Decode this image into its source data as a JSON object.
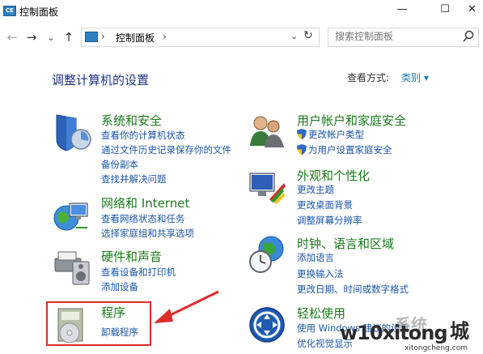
{
  "window": {
    "title": "控制面板",
    "minimize": "—",
    "maximize": "☐",
    "close": "✕"
  },
  "nav": {
    "back": "←",
    "forward": "→",
    "recent": "⌄",
    "up": "↑"
  },
  "address": {
    "path": "控制面板",
    "separator": "›",
    "dropdown": "⌄",
    "refresh": "↻"
  },
  "search": {
    "placeholder": "搜索控制面板"
  },
  "header": {
    "title": "调整计算机的设置",
    "view_by_label": "查看方式:",
    "view_by_value": "类别 ▾"
  },
  "categories": {
    "system": {
      "title": "系统和安全",
      "links": [
        "查看你的计算机状态",
        "通过文件历史记录保存你的文件",
        "备份副本",
        "查找并解决问题"
      ]
    },
    "network": {
      "title": "网络和 Internet",
      "links": [
        "查看网络状态和任务",
        "选择家庭组和共享选项"
      ]
    },
    "hardware": {
      "title": "硬件和声音",
      "links": [
        "查看设备和打印机",
        "添加设备"
      ]
    },
    "programs": {
      "title": "程序",
      "links": [
        "卸载程序"
      ]
    },
    "users": {
      "title": "用户帐户和家庭安全",
      "links": [
        "更改帐户类型",
        "为用户设置家庭安全"
      ]
    },
    "appearance": {
      "title": "外观和个性化",
      "links": [
        "更改主题",
        "更改桌面背景",
        "调整屏幕分辨率"
      ]
    },
    "clock": {
      "title": "时钟、语言和区域",
      "links": [
        "添加语言",
        "更换输入法",
        "更改日期、时间或数字格式"
      ]
    },
    "ease": {
      "title": "轻松使用",
      "links": [
        "使用 Windows 建议的设置",
        "优化视觉显示"
      ]
    }
  },
  "watermark": {
    "brand": "w10xitong",
    "suffix": "城",
    "url": "xitongcheng.com",
    "cn": "系统"
  },
  "colors": {
    "title_green": "#1a7b1a",
    "link_blue": "#1a56a8",
    "heading_blue": "#1e3287",
    "highlight_red": "#e02b2b"
  }
}
